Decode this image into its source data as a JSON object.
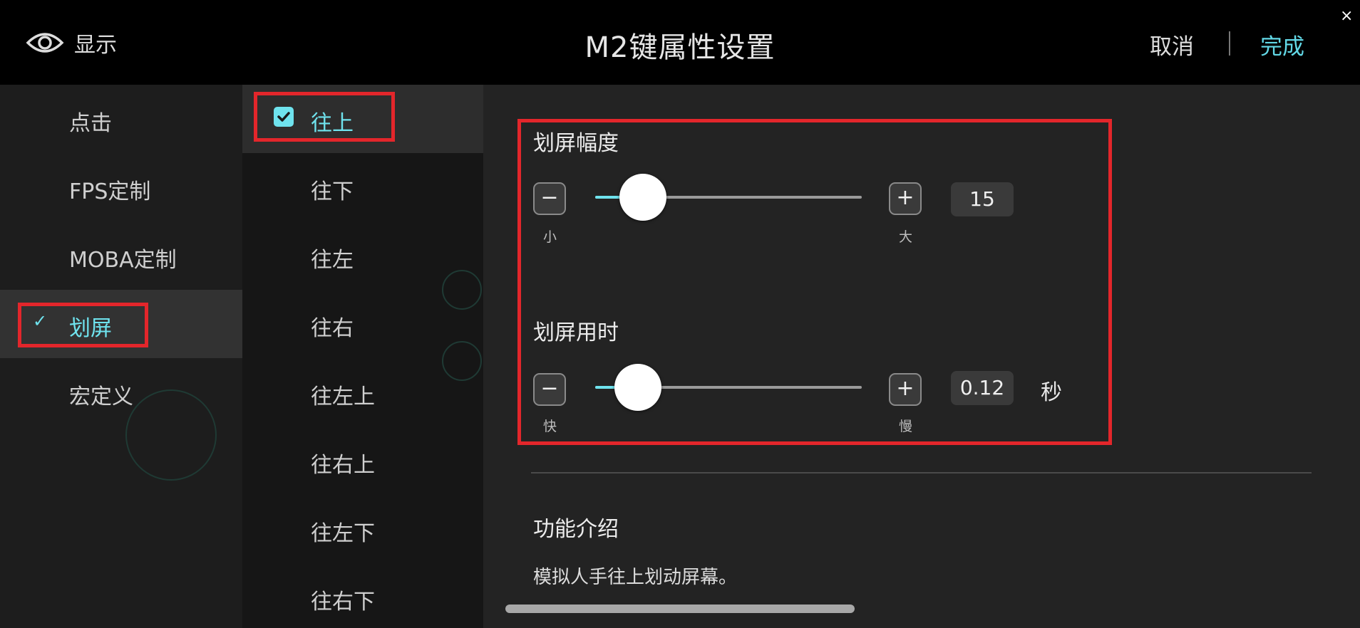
{
  "header": {
    "display_label": "显示",
    "title": "M2键属性设置",
    "cancel_label": "取消",
    "done_label": "完成",
    "close_label": "×"
  },
  "sidebar": {
    "items": [
      {
        "label": "点击",
        "active": false
      },
      {
        "label": "FPS定制",
        "active": false
      },
      {
        "label": "MOBA定制",
        "active": false
      },
      {
        "label": "划屏",
        "active": true
      },
      {
        "label": "宏定义",
        "active": false
      }
    ],
    "check_glyph": "✓"
  },
  "directions": {
    "items": [
      {
        "label": "往上",
        "selected": true
      },
      {
        "label": "往下",
        "selected": false
      },
      {
        "label": "往左",
        "selected": false
      },
      {
        "label": "往右",
        "selected": false
      },
      {
        "label": "往左上",
        "selected": false
      },
      {
        "label": "往右上",
        "selected": false
      },
      {
        "label": "往左下",
        "selected": false
      },
      {
        "label": "往右下",
        "selected": false
      }
    ]
  },
  "swipe_amplitude": {
    "title": "划屏幅度",
    "minus_glyph": "−",
    "plus_glyph": "+",
    "min_label": "小",
    "max_label": "大",
    "value": "15",
    "slider_fraction": 0.18
  },
  "swipe_duration": {
    "title": "划屏用时",
    "minus_glyph": "−",
    "plus_glyph": "+",
    "min_label": "快",
    "max_label": "慢",
    "value": "0.12",
    "unit": "秒",
    "slider_fraction": 0.16
  },
  "feature_intro": {
    "title": "功能介绍",
    "description": "模拟人手往上划动屏幕。"
  },
  "colors": {
    "accent": "#6fe3ee",
    "highlight_box": "#e3262b"
  }
}
